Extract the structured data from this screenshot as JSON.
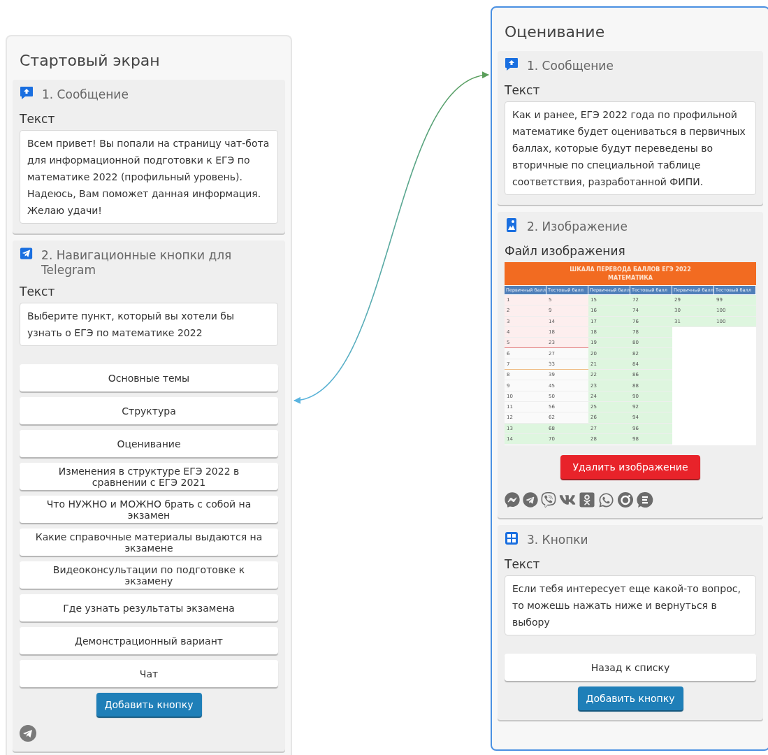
{
  "panels": [
    {
      "title": "Стартовый экран",
      "selected": false,
      "blocks": [
        {
          "kind": "message",
          "title": "1. Сообщение",
          "field_label": "Текст",
          "text": "Всем привет! Вы попали на страницу чат-бота для информационной подготовки к ЕГЭ по математике 2022 (профильный уровень). Надеюсь, Вам поможет данная информация. Желаю удачи!"
        },
        {
          "kind": "telegram_buttons",
          "title": "2. Навигационные кнопки для Telegram",
          "field_label": "Текст",
          "text": "Выберите пункт, который вы хотели бы узнать о ЕГЭ по математике 2022",
          "buttons": [
            "Основные темы",
            "Структура",
            "Оценивание",
            "Изменения в структуре ЕГЭ 2022 в сравнении с ЕГЭ 2021",
            "Что НУЖНО и МОЖНО брать с собой на экзамен",
            "Какие справочные материалы выдаются на экзамене",
            "Видеоконсультации по подготовке к экзамену",
            "Где узнать результаты экзамена",
            "Демонстрационный вариант",
            "Чат"
          ],
          "add_button": "Добавить кнопку"
        }
      ]
    },
    {
      "title": "Оценивание",
      "selected": true,
      "blocks": [
        {
          "kind": "message",
          "title": "1. Сообщение",
          "field_label": "Текст",
          "text": "Как и ранее, ЕГЭ 2022 года по профильной математике будет оцениваться в первичных баллах, которые будут переведены во вторичные по специальной таблице соответствия, разработанной ФИПИ."
        },
        {
          "kind": "image",
          "title": "2. Изображение",
          "field_label": "Файл изображения",
          "image_table": {
            "title_lines": [
              "ШКАЛА ПЕРЕВОДА БАЛЛОВ ЕГЭ 2022",
              "МАТЕМАТИКА"
            ],
            "headers": [
              "Первичный балл",
              "Тестовый балл",
              "Первичный балл",
              "Тестовый балл",
              "Первичный балл",
              "Тестовый балл"
            ],
            "groups": [
              {
                "entries": [
                  {
                    "primary": "1",
                    "test": "5",
                    "kind": "low"
                  },
                  {
                    "primary": "2",
                    "test": "9",
                    "kind": "low"
                  },
                  {
                    "primary": "3",
                    "test": "14",
                    "kind": "low"
                  },
                  {
                    "primary": "4",
                    "test": "18",
                    "kind": "low"
                  },
                  {
                    "primary": "5",
                    "test": "23",
                    "kind": "lowedge"
                  },
                  {
                    "primary": "6",
                    "test": "27",
                    "kind": "mid"
                  },
                  {
                    "primary": "7",
                    "test": "33",
                    "kind": "midedge"
                  },
                  {
                    "primary": "8",
                    "test": "39",
                    "kind": "mid"
                  },
                  {
                    "primary": "9",
                    "test": "45",
                    "kind": "mid"
                  },
                  {
                    "primary": "10",
                    "test": "50",
                    "kind": "mid"
                  },
                  {
                    "primary": "11",
                    "test": "56",
                    "kind": "mid"
                  },
                  {
                    "primary": "12",
                    "test": "62",
                    "kind": "mid"
                  },
                  {
                    "primary": "13",
                    "test": "68",
                    "kind": "high"
                  },
                  {
                    "primary": "14",
                    "test": "70",
                    "kind": "high"
                  }
                ]
              },
              {
                "entries": [
                  {
                    "primary": "15",
                    "test": "72",
                    "kind": "high"
                  },
                  {
                    "primary": "16",
                    "test": "74",
                    "kind": "high"
                  },
                  {
                    "primary": "17",
                    "test": "76",
                    "kind": "high"
                  },
                  {
                    "primary": "18",
                    "test": "78",
                    "kind": "high"
                  },
                  {
                    "primary": "19",
                    "test": "80",
                    "kind": "high"
                  },
                  {
                    "primary": "20",
                    "test": "82",
                    "kind": "high"
                  },
                  {
                    "primary": "21",
                    "test": "84",
                    "kind": "high"
                  },
                  {
                    "primary": "22",
                    "test": "86",
                    "kind": "high"
                  },
                  {
                    "primary": "23",
                    "test": "88",
                    "kind": "high"
                  },
                  {
                    "primary": "24",
                    "test": "90",
                    "kind": "high"
                  },
                  {
                    "primary": "25",
                    "test": "92",
                    "kind": "high"
                  },
                  {
                    "primary": "26",
                    "test": "94",
                    "kind": "high"
                  },
                  {
                    "primary": "27",
                    "test": "96",
                    "kind": "high"
                  },
                  {
                    "primary": "28",
                    "test": "98",
                    "kind": "high"
                  }
                ]
              },
              {
                "entries": [
                  {
                    "primary": "29",
                    "test": "99",
                    "kind": "high"
                  },
                  {
                    "primary": "30",
                    "test": "100",
                    "kind": "high"
                  },
                  {
                    "primary": "31",
                    "test": "100",
                    "kind": "high"
                  }
                ]
              }
            ]
          },
          "delete_button": "Удалить изображение"
        },
        {
          "kind": "buttons",
          "title": "3. Кнопки",
          "field_label": "Текст",
          "text": "Если тебя интересует еще какой-то вопрос, то можешь нажать ниже и вернуться в выбору",
          "buttons": [
            "Назад к списку"
          ],
          "add_button": "Добавить кнопку"
        }
      ]
    }
  ]
}
